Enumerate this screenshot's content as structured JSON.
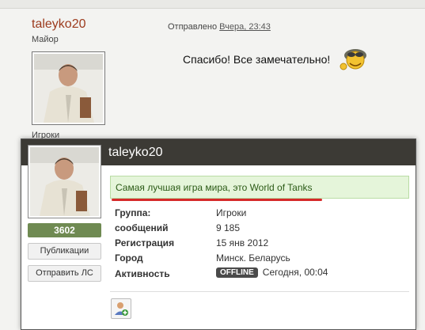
{
  "post": {
    "author_name": "taleyko20",
    "author_rank": "Майор",
    "author_group": "Игроки",
    "posted_prefix": "Отправлено",
    "posted_date": "Вчера, 23:43",
    "message": "Спасибо! Все замечательно!"
  },
  "hovercard": {
    "username": "taleyko20",
    "reputation": "3602",
    "buttons": {
      "publications": "Публикации",
      "send_pm": "Отправить ЛС"
    },
    "status": "Самая лучшая игра мира, это World of Tanks",
    "fields": [
      {
        "label": "Группа:",
        "value": "Игроки"
      },
      {
        "label": "сообщений",
        "value": "9 185"
      },
      {
        "label": "Регистрация",
        "value": "15 янв 2012"
      },
      {
        "label": "Город",
        "value": "Минск. Беларусь"
      },
      {
        "label": "Активность",
        "badge": "OFFLINE",
        "value": "Сегодня, 00:04"
      }
    ],
    "icons": [
      "add-friend-icon",
      "smiley-icon",
      "avatar-photo"
    ]
  },
  "colors": {
    "author_name": "#9c3a1d",
    "reputation": "#6f8a52",
    "status_bg": "#e5f5da",
    "underline": "#d62a2a",
    "card_header": "#3c3a35"
  }
}
